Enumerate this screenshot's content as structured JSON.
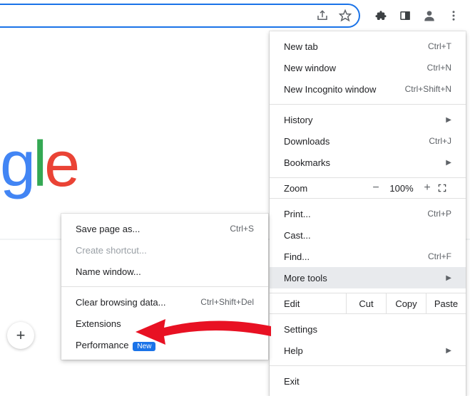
{
  "toolbar": {
    "share_icon": "share",
    "star_icon": "star",
    "ext_icon": "puzzle",
    "panel_icon": "panel",
    "profile_icon": "profile",
    "more_icon": "more"
  },
  "logo": {
    "g": "g",
    "l": "l",
    "e": "e"
  },
  "menu": {
    "new_tab": "New tab",
    "new_tab_sc": "Ctrl+T",
    "new_window": "New window",
    "new_window_sc": "Ctrl+N",
    "incognito": "New Incognito window",
    "incognito_sc": "Ctrl+Shift+N",
    "history": "History",
    "downloads": "Downloads",
    "downloads_sc": "Ctrl+J",
    "bookmarks": "Bookmarks",
    "zoom": "Zoom",
    "zoom_minus": "−",
    "zoom_val": "100%",
    "zoom_plus": "+",
    "print": "Print...",
    "print_sc": "Ctrl+P",
    "cast": "Cast...",
    "find": "Find...",
    "find_sc": "Ctrl+F",
    "more_tools": "More tools",
    "edit": "Edit",
    "cut": "Cut",
    "copy": "Copy",
    "paste": "Paste",
    "settings": "Settings",
    "help": "Help",
    "exit": "Exit"
  },
  "submenu": {
    "save_page": "Save page as...",
    "save_page_sc": "Ctrl+S",
    "create_shortcut": "Create shortcut...",
    "name_window": "Name window...",
    "clear_data": "Clear browsing data...",
    "clear_data_sc": "Ctrl+Shift+Del",
    "extensions": "Extensions",
    "performance": "Performance",
    "badge_new": "New"
  },
  "plus": "+"
}
